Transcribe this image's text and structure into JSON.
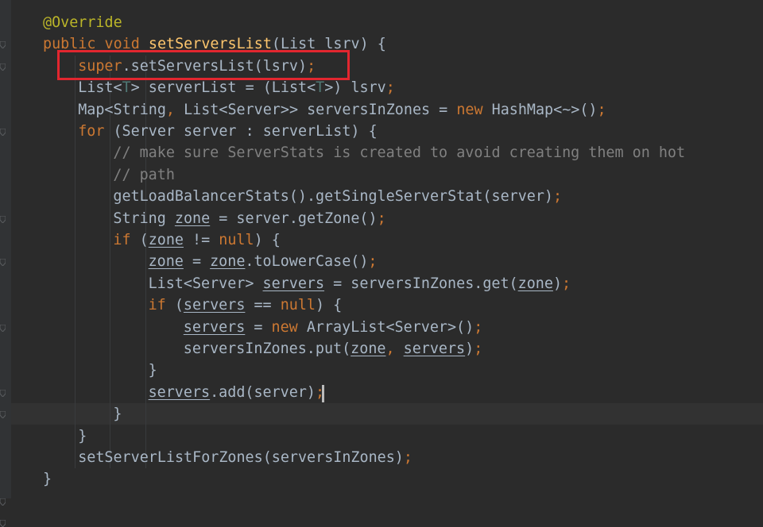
{
  "editor": {
    "language": "java",
    "caret_line": 18,
    "highlighted_line": 2,
    "colors": {
      "background": "#2b2b2b",
      "keyword": "#cc7832",
      "annotation": "#bbb529",
      "method_declaration": "#ffc66d",
      "comment": "#808080",
      "plain": "#a9b7c6",
      "highlight_box": "#e2262f"
    },
    "fold_markers": [
      1,
      2,
      5,
      9,
      11,
      14,
      17,
      18,
      22,
      23
    ],
    "lines": [
      {
        "indent": 0,
        "tokens": [
          {
            "t": "@Override",
            "c": "ann"
          }
        ]
      },
      {
        "indent": 0,
        "tokens": [
          {
            "t": "public ",
            "c": "kw"
          },
          {
            "t": "void ",
            "c": "kw"
          },
          {
            "t": "setServersList",
            "c": "fn"
          },
          {
            "t": "(List lsrv) {"
          }
        ]
      },
      {
        "indent": 1,
        "tokens": [
          {
            "t": "super",
            "c": "kw"
          },
          {
            "t": ".setServersList(lsrv)"
          },
          {
            "t": ";",
            "c": "kw"
          }
        ]
      },
      {
        "indent": 1,
        "tokens": [
          {
            "t": "List<"
          },
          {
            "t": "T",
            "c": "tp"
          },
          {
            "t": "> serverList = (List<"
          },
          {
            "t": "T",
            "c": "tp"
          },
          {
            "t": ">) lsrv"
          },
          {
            "t": ";",
            "c": "kw"
          }
        ]
      },
      {
        "indent": 1,
        "tokens": [
          {
            "t": "Map<String"
          },
          {
            "t": ", ",
            "c": "kw"
          },
          {
            "t": "List<Server>> serversInZones = "
          },
          {
            "t": "new ",
            "c": "kw"
          },
          {
            "t": "HashMap"
          },
          {
            "t": "<~>",
            "c": "fold"
          },
          {
            "t": "()"
          },
          {
            "t": ";",
            "c": "kw"
          }
        ]
      },
      {
        "indent": 1,
        "tokens": [
          {
            "t": "for ",
            "c": "kw"
          },
          {
            "t": "(Server server : serverList) {"
          }
        ]
      },
      {
        "indent": 2,
        "tokens": [
          {
            "t": "// make sure ServerStats is created to avoid creating them on hot",
            "c": "cm"
          }
        ]
      },
      {
        "indent": 2,
        "tokens": [
          {
            "t": "// path",
            "c": "cm"
          }
        ]
      },
      {
        "indent": 2,
        "tokens": [
          {
            "t": "getLoadBalancerStats().getSingleServerStat(server)"
          },
          {
            "t": ";",
            "c": "kw"
          }
        ]
      },
      {
        "indent": 2,
        "tokens": [
          {
            "t": "String "
          },
          {
            "t": "zone",
            "c": "ul"
          },
          {
            "t": " = server.getZone()"
          },
          {
            "t": ";",
            "c": "kw"
          }
        ]
      },
      {
        "indent": 2,
        "tokens": [
          {
            "t": "if ",
            "c": "kw"
          },
          {
            "t": "("
          },
          {
            "t": "zone",
            "c": "ul"
          },
          {
            "t": " != "
          },
          {
            "t": "null",
            "c": "kw"
          },
          {
            "t": ") {"
          }
        ]
      },
      {
        "indent": 3,
        "tokens": [
          {
            "t": "zone",
            "c": "ul"
          },
          {
            "t": " = "
          },
          {
            "t": "zone",
            "c": "ul"
          },
          {
            "t": ".toLowerCase()"
          },
          {
            "t": ";",
            "c": "kw"
          }
        ]
      },
      {
        "indent": 3,
        "tokens": [
          {
            "t": "List<Server> "
          },
          {
            "t": "servers",
            "c": "ul"
          },
          {
            "t": " = serversInZones.get("
          },
          {
            "t": "zone",
            "c": "ul"
          },
          {
            "t": ")"
          },
          {
            "t": ";",
            "c": "kw"
          }
        ]
      },
      {
        "indent": 3,
        "tokens": [
          {
            "t": "if ",
            "c": "kw"
          },
          {
            "t": "("
          },
          {
            "t": "servers",
            "c": "ul"
          },
          {
            "t": " == "
          },
          {
            "t": "null",
            "c": "kw"
          },
          {
            "t": ") {"
          }
        ]
      },
      {
        "indent": 4,
        "tokens": [
          {
            "t": "servers",
            "c": "ul"
          },
          {
            "t": " = "
          },
          {
            "t": "new ",
            "c": "kw"
          },
          {
            "t": "ArrayList<Server>()"
          },
          {
            "t": ";",
            "c": "kw"
          }
        ]
      },
      {
        "indent": 4,
        "tokens": [
          {
            "t": "serversInZones.put("
          },
          {
            "t": "zone",
            "c": "ul"
          },
          {
            "t": ", ",
            "c": "kw"
          },
          {
            "t": "servers",
            "c": "ul"
          },
          {
            "t": ")"
          },
          {
            "t": ";",
            "c": "kw"
          }
        ]
      },
      {
        "indent": 3,
        "tokens": [
          {
            "t": "}"
          }
        ]
      },
      {
        "indent": 3,
        "tokens": [
          {
            "t": "servers",
            "c": "ul"
          },
          {
            "t": ".add(server)"
          },
          {
            "t": ";",
            "c": "kw"
          }
        ]
      },
      {
        "indent": 2,
        "tokens": [
          {
            "t": "}"
          }
        ]
      },
      {
        "indent": 1,
        "tokens": [
          {
            "t": "}"
          }
        ]
      },
      {
        "indent": 1,
        "tokens": [
          {
            "t": "setServerListForZones(serversInZones)"
          },
          {
            "t": ";",
            "c": "kw"
          }
        ]
      },
      {
        "indent": 0,
        "tokens": [
          {
            "t": "}"
          }
        ]
      }
    ]
  }
}
